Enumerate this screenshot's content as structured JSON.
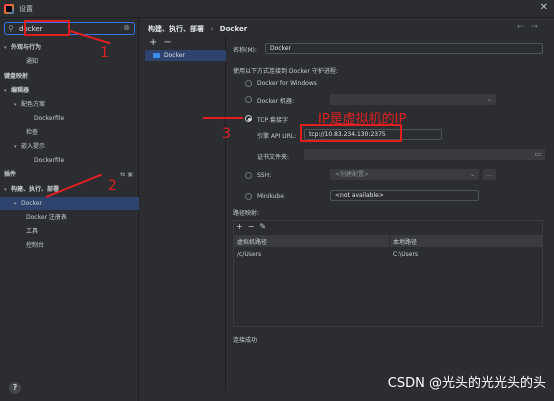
{
  "window": {
    "title": "设置"
  },
  "sidebar": {
    "search_value": "docker",
    "items": [
      {
        "label": "外观与行为",
        "level": 0,
        "expanded": true,
        "bold": true
      },
      {
        "label": "通知",
        "level": 2
      },
      {
        "label": "键盘映射",
        "level": 0,
        "bold": true
      },
      {
        "label": "编辑器",
        "level": 0,
        "expanded": true,
        "bold": true
      },
      {
        "label": "配色方案",
        "level": 1,
        "expanded": true
      },
      {
        "label": "Dockerfile",
        "level": 3
      },
      {
        "label": "检查",
        "level": 2
      },
      {
        "label": "嵌入提示",
        "level": 1,
        "expanded": true
      },
      {
        "label": "Dockerfile",
        "level": 3
      },
      {
        "label": "插件",
        "level": 0,
        "bold": true
      },
      {
        "label": "构建、执行、部署",
        "level": 0,
        "expanded": true,
        "bold": true
      },
      {
        "label": "Docker",
        "level": 1,
        "expanded": true,
        "selected": true
      },
      {
        "label": "Docker 注册表",
        "level": 2
      },
      {
        "label": "工具",
        "level": 2
      },
      {
        "label": "控制台",
        "level": 2
      }
    ]
  },
  "breadcrumb": {
    "parent": "构建、执行、部署",
    "separator": "›",
    "current": "Docker"
  },
  "list": {
    "items": [
      "Docker"
    ]
  },
  "form": {
    "name_label": "名称(M):",
    "name_value": "Docker",
    "connect_label": "使用以下方式连接到 Docker 守护进程:",
    "options": {
      "windows": "Docker for Windows",
      "machine": "Docker 机器:",
      "tcp": "TCP 套接字",
      "ssh": "SSH:",
      "minikube": "Minikube"
    },
    "api_url_label": "引擎 API URL:",
    "api_url_value": "tcp://10.83.234.130:2375",
    "cert_label": "证书文件夹:",
    "ssh_placeholder": "<创建配置>",
    "ssh_more": "...",
    "minikube_value": "<not available>",
    "mappings_label": "路径映射:",
    "mapping_columns": [
      "虚拟机路径",
      "本地路径"
    ],
    "mapping_rows": [
      {
        "vm": "/c/Users",
        "local": "C:\\Users"
      }
    ],
    "status": "连接成功"
  },
  "annotations": {
    "ip_note": "IP是虚拟机的IP",
    "num1": "1",
    "num2": "2",
    "num3": "3",
    "color": "#e02020"
  },
  "watermark": "CSDN @光头的光光头的头"
}
